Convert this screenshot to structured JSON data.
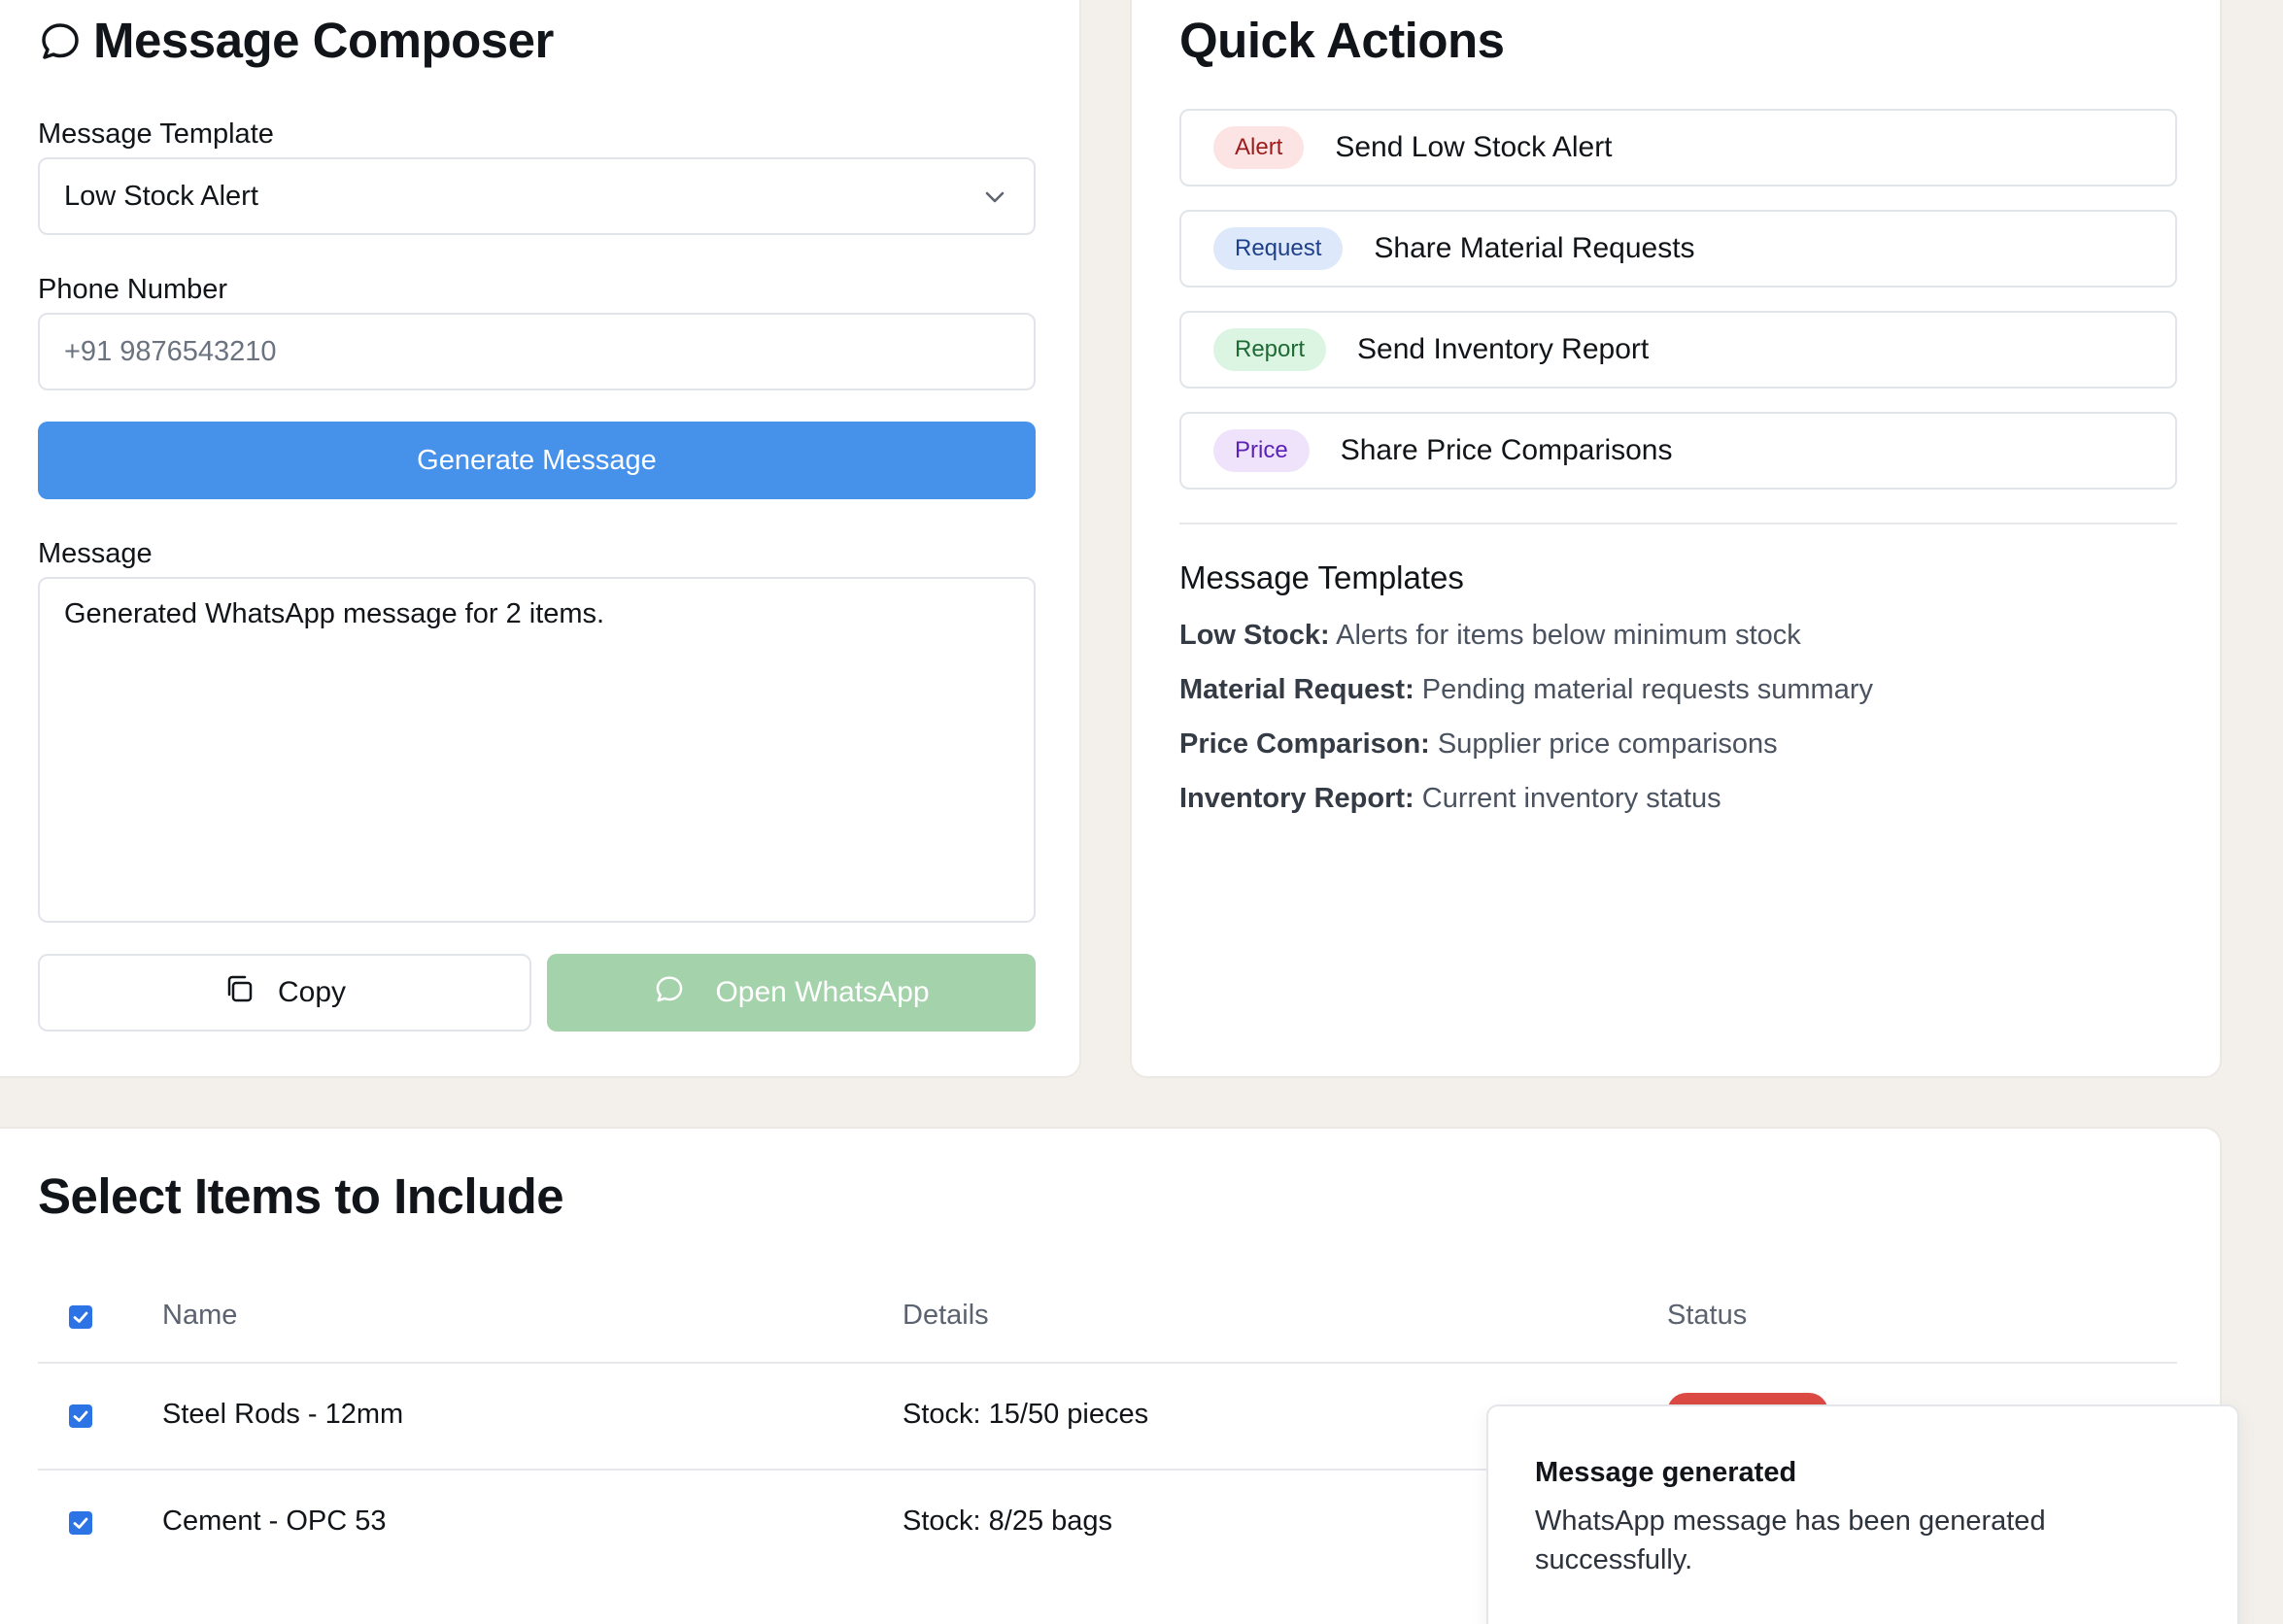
{
  "composer": {
    "title": "Message Composer",
    "template_label": "Message Template",
    "template_value": "Low Stock Alert",
    "phone_label": "Phone Number",
    "phone_placeholder": "+91 9876543210",
    "generate_label": "Generate Message",
    "message_label": "Message",
    "message_value": "Generated WhatsApp message for 2 items.",
    "copy_label": "Copy",
    "whatsapp_label": "Open WhatsApp"
  },
  "quick_actions": {
    "title": "Quick Actions",
    "actions": [
      {
        "badge": "Alert",
        "label": "Send Low Stock Alert",
        "badge_bg": "#fde4e4",
        "badge_fg": "#9b1c1c"
      },
      {
        "badge": "Request",
        "label": "Share Material Requests",
        "badge_bg": "#dde9fb",
        "badge_fg": "#1e3f8a"
      },
      {
        "badge": "Report",
        "label": "Send Inventory Report",
        "badge_bg": "#dcf5e2",
        "badge_fg": "#1e6a34"
      },
      {
        "badge": "Price",
        "label": "Share Price Comparisons",
        "badge_bg": "#efe3fb",
        "badge_fg": "#5b21b6"
      }
    ],
    "templates_title": "Message Templates",
    "templates": [
      {
        "name": "Low Stock:",
        "desc": "Alerts for items below minimum stock"
      },
      {
        "name": "Material Request:",
        "desc": "Pending material requests summary"
      },
      {
        "name": "Price Comparison:",
        "desc": "Supplier price comparisons"
      },
      {
        "name": "Inventory Report:",
        "desc": "Current inventory status"
      }
    ]
  },
  "items": {
    "title": "Select Items to Include",
    "columns": [
      "Name",
      "Details",
      "Status"
    ],
    "rows": [
      {
        "name": "Steel Rods - 12mm",
        "details": "Stock: 15/50 pieces"
      },
      {
        "name": "Cement - OPC 53",
        "details": "Stock: 8/25 bags"
      }
    ]
  },
  "toast": {
    "title": "Message generated",
    "body": "WhatsApp message has been generated successfully."
  },
  "colors": {
    "accent": "#4691ea",
    "whatsapp_disabled": "#a4d2aa",
    "status_low": "#dc4a44",
    "background": "#f3efea"
  },
  "icons": [
    "chat-bubble-icon",
    "chevron-down-icon",
    "copy-icon",
    "whatsapp-icon",
    "checkmark-icon"
  ]
}
